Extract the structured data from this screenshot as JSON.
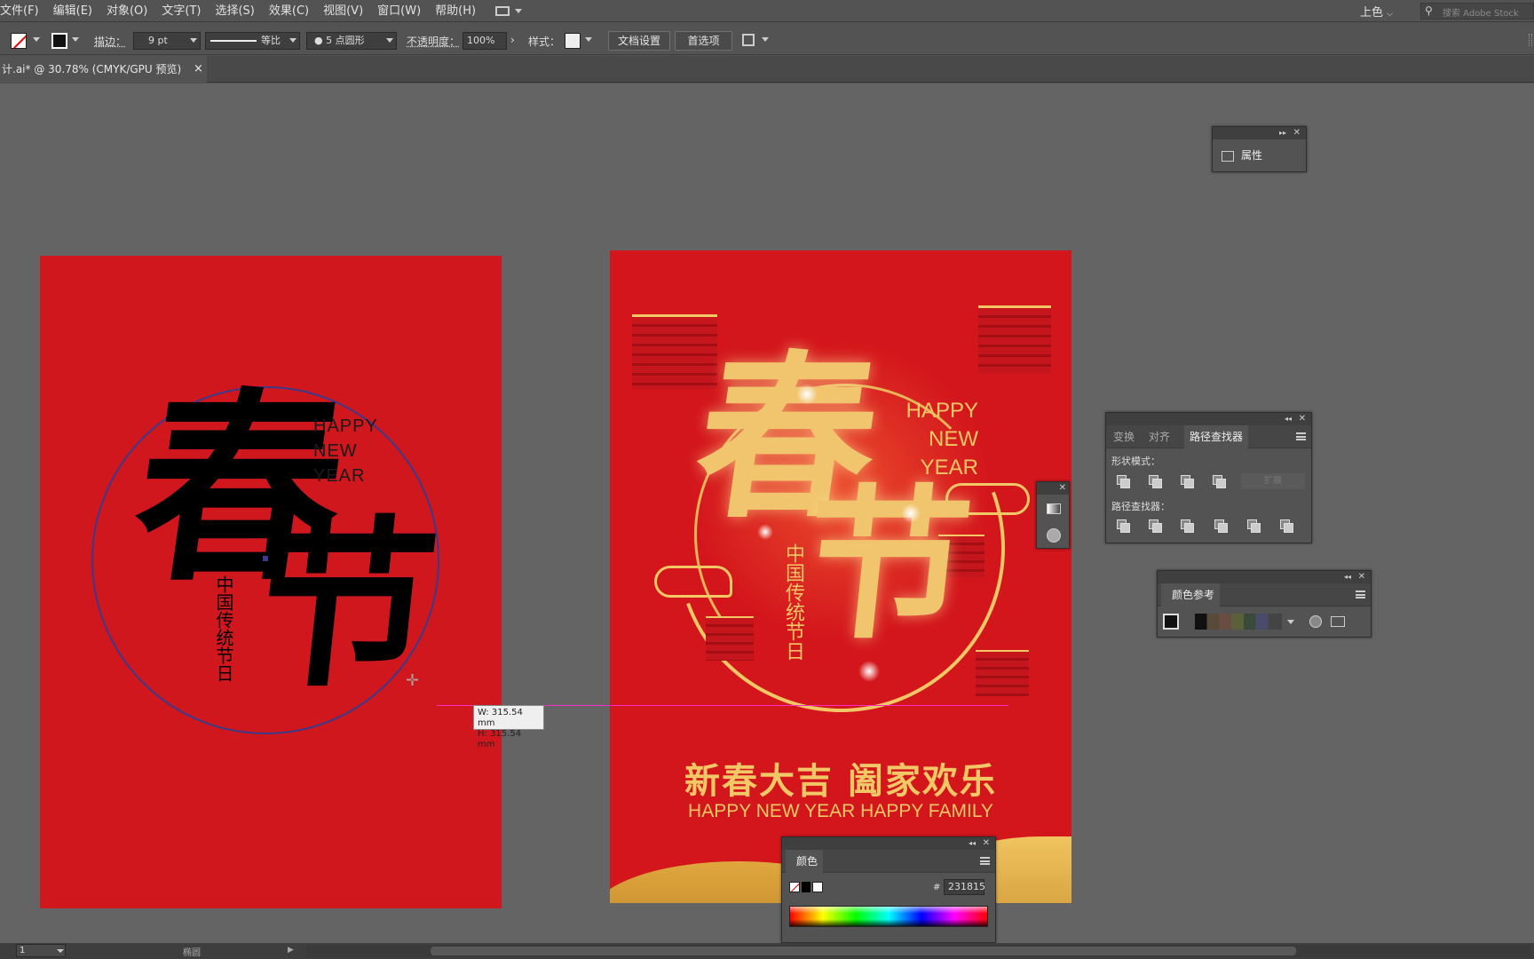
{
  "menu": [
    "文件(F)",
    "编辑(E)",
    "对象(O)",
    "文字(T)",
    "选择(S)",
    "效果(C)",
    "视图(V)",
    "窗口(W)",
    "帮助(H)"
  ],
  "workspace": "上色",
  "search_placeholder": "搜索 Adobe Stock",
  "control": {
    "stroke_label": "描边：",
    "stroke_value": "9 pt",
    "profile_label": "等比",
    "brush_label": "5 点圆形",
    "opacity_label": "不透明度：",
    "opacity_value": "100%",
    "style_label": "样式：",
    "doc_setup": "文档设置",
    "prefs": "首选项"
  },
  "doc_tab": {
    "title": "计.ai* @ 30.78% (CMYK/GPU 预览)",
    "close": "×"
  },
  "panels": {
    "properties": {
      "label": "属性"
    },
    "pathfinder": {
      "tabs": [
        "变换",
        "对齐",
        "路径查找器"
      ],
      "shape_modes": "形状模式：",
      "pathfinders": "路径查找器：",
      "expand": "扩展"
    },
    "color_guide": {
      "title": "颜色参考"
    },
    "color": {
      "title": "颜色",
      "hash": "#",
      "hex": "231815"
    }
  },
  "artboard_left": {
    "big_char1": "春",
    "big_char2": "节",
    "vertical": "中国传统节日",
    "eng": [
      "HAPPY",
      "NEW",
      "YEAR"
    ]
  },
  "artboard_right": {
    "big_char1": "春",
    "big_char2": "节",
    "vertical": "中国传统节日",
    "eng": [
      "HAPPY",
      "NEW",
      "YEAR"
    ],
    "slogan": "新春大吉 阖家欢乐",
    "slogan_en": "HAPPY NEW YEAR HAPPY FAMILY"
  },
  "measure": {
    "w": "W: 315.54 mm",
    "h": "H: 315.54 mm"
  },
  "status": {
    "page": "1",
    "tool": "椭圆"
  },
  "colors": {
    "artboard_red": "#d0171d",
    "gold": "#f2c766",
    "guide_magenta": "#ff2cc6"
  }
}
